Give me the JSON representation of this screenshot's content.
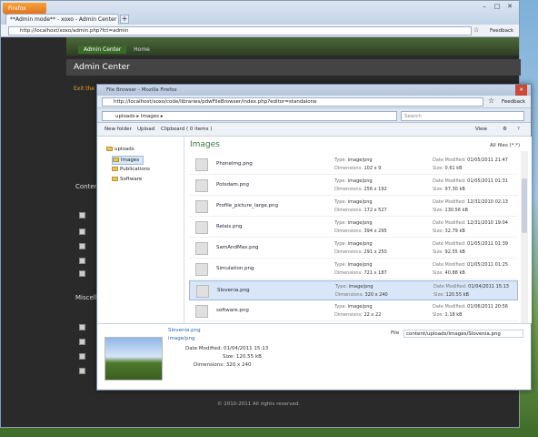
{
  "back_browser": {
    "menu_button": "Firefox",
    "tab_title": "**Admin mode** - xoxo - Admin Center",
    "new_tab": "+",
    "url": "http://localhost/xoxo/admin.php?fct=admin",
    "feedback": "Feedback",
    "nav": {
      "active": "Admin Center",
      "home": "Home"
    },
    "title": "Admin Center",
    "exit_prefix": "Exit the",
    "sections": {
      "content": "Content",
      "misc": "Miscell"
    },
    "copyright": "© 2010-2011 All rights reserved."
  },
  "popup": {
    "title_bar": "File Browser - Mozilla Firefox",
    "url": "http://localhost/xoxo/code/libraries/pdwFileBrowser/index.php?editor=standalone",
    "feedback": "Feedback",
    "path": [
      "uploads",
      "Images"
    ],
    "search_placeholder": "Search",
    "toolbar": {
      "new_folder": "New folder",
      "upload": "Upload",
      "clipboard": "Clipboard ( 0 items )",
      "view": "View"
    },
    "tree": {
      "root": "uploads",
      "children": [
        "Images",
        "Publications",
        "Software"
      ]
    },
    "main_title": "Images",
    "all_files": "All files (*.*)",
    "file_labels": {
      "type": "Type:",
      "dimensions": "Dimensions:",
      "date": "Date Modified:",
      "size": "Size:"
    },
    "files": [
      {
        "name": "PhoneImg.png",
        "type": "image/png",
        "dims": "102 x 9",
        "date": "01/05/2011 21:47",
        "size": "0.61 kB"
      },
      {
        "name": "Potsdam.png",
        "type": "image/png",
        "dims": "256 x 192",
        "date": "01/05/2011 01:31",
        "size": "97.30 kB"
      },
      {
        "name": "Profile_picture_large.png",
        "type": "image/png",
        "dims": "172 x 527",
        "date": "12/31/2010 02:13",
        "size": "130.56 kB"
      },
      {
        "name": "Relais.png",
        "type": "image/png",
        "dims": "394 x 295",
        "date": "12/31/2010 19:04",
        "size": "32.79 kB"
      },
      {
        "name": "SamAndMax.png",
        "type": "image/png",
        "dims": "291 x 250",
        "date": "01/05/2011 01:39",
        "size": "92.55 kB"
      },
      {
        "name": "Simulation.png",
        "type": "image/png",
        "dims": "721 x 187",
        "date": "01/05/2011 01:25",
        "size": "40.88 kB"
      },
      {
        "name": "Slovenia.png",
        "type": "image/png",
        "dims": "320 x 240",
        "date": "01/04/2011 15:13",
        "size": "120.55 kB"
      },
      {
        "name": "software.png",
        "type": "image/png",
        "dims": "22 x 22",
        "date": "01/06/2011 20:56",
        "size": "1.18 kB"
      }
    ],
    "details": {
      "name": "Slovenia.png",
      "type": "image/png",
      "date": "Date Modified: 01/04/2011 15:13",
      "size": "Size: 120.55 kB",
      "dims": "Dimensions: 320 x 240",
      "file_label": "File",
      "file_url": "content/uploads/Images/Slovenia.png"
    }
  }
}
